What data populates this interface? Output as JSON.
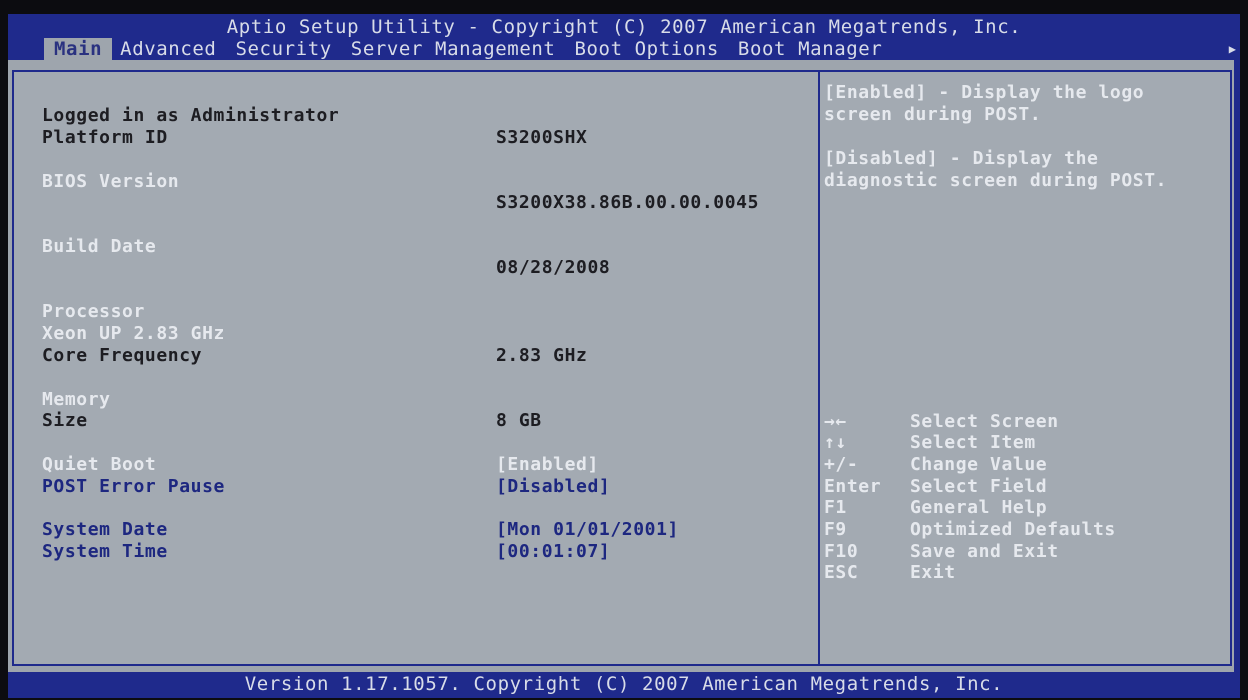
{
  "window": {
    "title": "Aptio Setup Utility - Copyright (C) 2007 American Megatrends, Inc.",
    "footer": "Version 1.17.1057. Copyright (C) 2007 American Megatrends, Inc."
  },
  "tabs": [
    {
      "label": "Main",
      "active": true
    },
    {
      "label": "Advanced",
      "active": false
    },
    {
      "label": "Security",
      "active": false
    },
    {
      "label": "Server Management",
      "active": false
    },
    {
      "label": "Boot Options",
      "active": false
    },
    {
      "label": "Boot Manager",
      "active": false
    }
  ],
  "main": {
    "logged_in": "Logged in as Administrator",
    "platform_id": {
      "label": "Platform ID",
      "value": "S3200SHX"
    },
    "bios_version": {
      "label": "BIOS Version",
      "value": "S3200X38.86B.00.00.0045"
    },
    "build_date": {
      "label": "Build Date",
      "value": "08/28/2008"
    },
    "processor": {
      "label": "Processor",
      "model": "Xeon UP 2.83 GHz"
    },
    "core_frequency": {
      "label": "Core Frequency",
      "value": "2.83 GHz"
    },
    "memory": {
      "label": "Memory"
    },
    "size": {
      "label": "Size",
      "value": "8 GB"
    },
    "quiet_boot": {
      "label": "Quiet Boot",
      "value": "[Enabled]"
    },
    "post_error_pause": {
      "label": "POST Error Pause",
      "value": "[Disabled]"
    },
    "system_date": {
      "label": "System Date",
      "value": "[Mon 01/01/2001]"
    },
    "system_time": {
      "label": "System Time",
      "value": "[00:01:07]"
    }
  },
  "help": {
    "enabled_text": "[Enabled] - Display the logo screen during POST.",
    "disabled_text": "[Disabled] - Display the diagnostic screen during POST."
  },
  "keys": [
    {
      "key": "→←",
      "desc": "Select Screen"
    },
    {
      "key": "↑↓",
      "desc": "Select Item"
    },
    {
      "key": "+/-",
      "desc": "Change Value"
    },
    {
      "key": "Enter",
      "desc": "Select Field"
    },
    {
      "key": "F1",
      "desc": "General Help"
    },
    {
      "key": "F9",
      "desc": "Optimized Defaults"
    },
    {
      "key": "F10",
      "desc": "Save and Exit"
    },
    {
      "key": "ESC",
      "desc": "Exit"
    }
  ],
  "colors": {
    "frame_blue": "#1f2a8c",
    "panel_gray": "#a3aab2",
    "selected_text": "#1d2780",
    "highlight_text": "#e6e9ee"
  }
}
